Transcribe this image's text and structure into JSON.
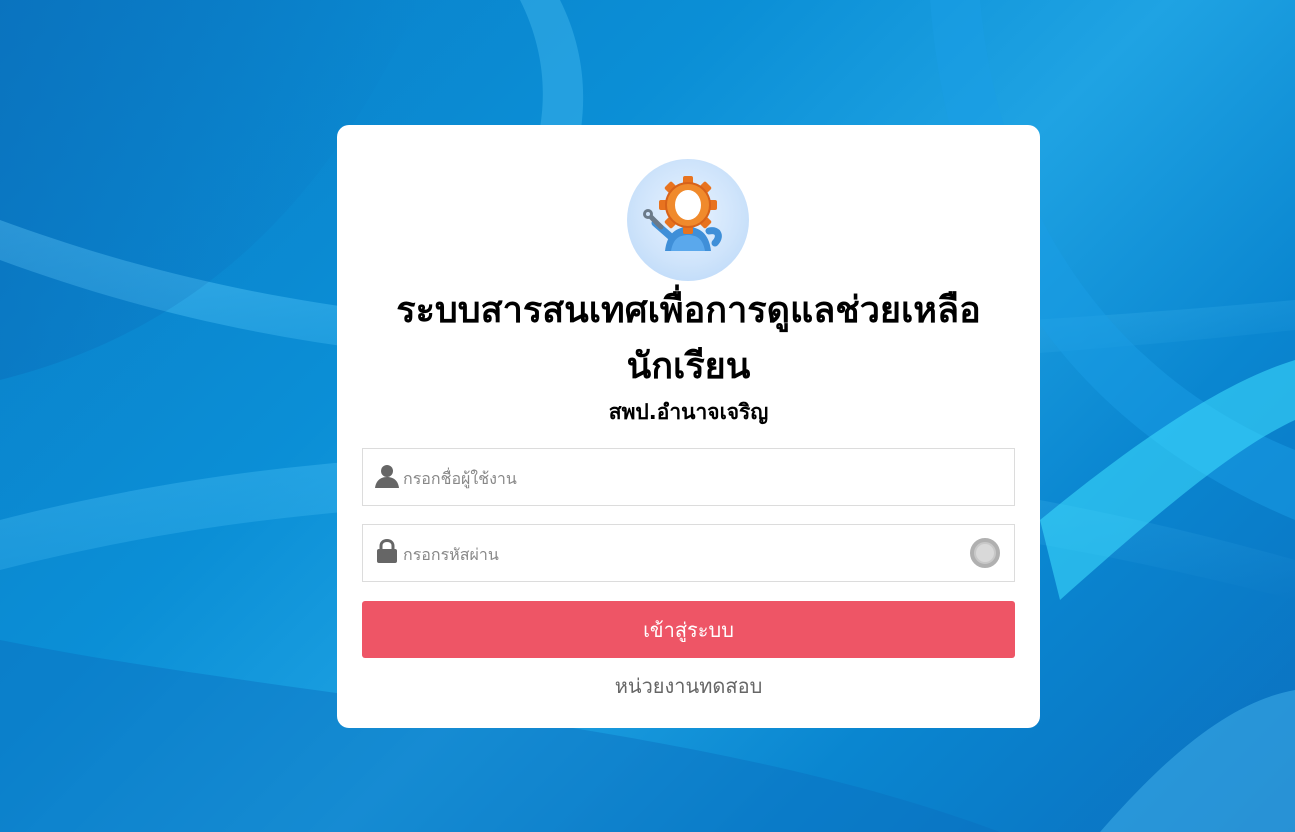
{
  "app": {
    "title": "ระบบสารสนเทศเพื่อการดูแลช่วยเหลือนักเรียน",
    "subtitle": "สพป.อำนาจเจริญ"
  },
  "login": {
    "username_placeholder": "กรอกชื่อผู้ใช้งาน",
    "password_placeholder": "กรอกรหัสผ่าน",
    "submit_label": "เข้าสู่ระบบ",
    "footer_link": "หน่วยงานทดสอบ"
  },
  "icons": {
    "logo": "gear-mascot-icon",
    "username": "user-icon",
    "password": "lock-icon",
    "password_toggle": "show-password-toggle"
  },
  "colors": {
    "background": "#0b8fd6",
    "card": "#ffffff",
    "primary_button": "#ee5566",
    "footer_text": "#666666"
  }
}
